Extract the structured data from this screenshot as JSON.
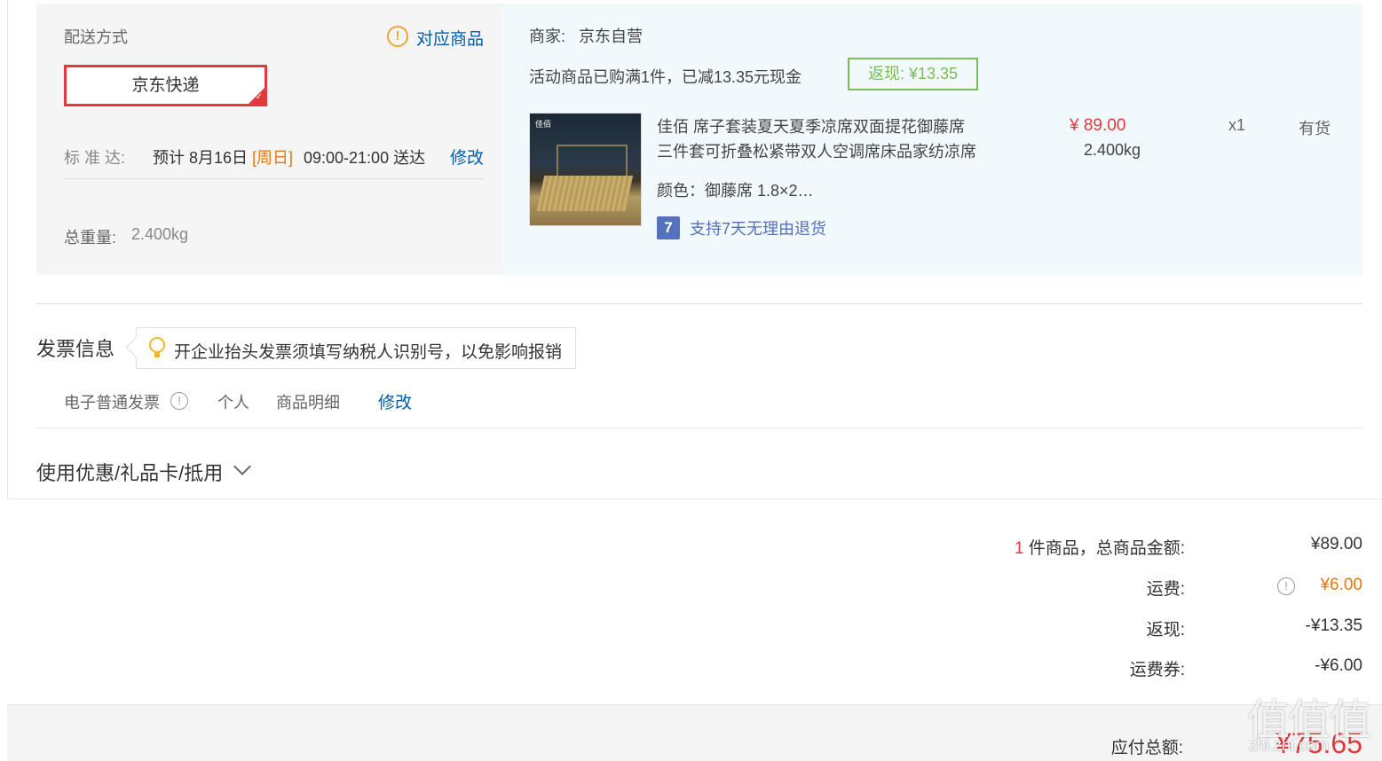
{
  "shipping": {
    "method_label": "配送方式",
    "products_link": "对应商品",
    "option": "京东快递",
    "standard_label": "标 准 达:",
    "estimate_prefix": "预计 8月16日",
    "estimate_day": "[周日]",
    "estimate_time": "09:00-21:00 送达",
    "edit_link": "修改",
    "total_weight_label": "总重量:",
    "total_weight": "2.400kg"
  },
  "merchant": {
    "label": "商家:",
    "name": "京东自营",
    "promo_text": "活动商品已购满1件，已减13.35元现金",
    "cashback": "返现: ¥13.35"
  },
  "product": {
    "image_brand": "佳佰",
    "title_line1": "佳佰 席子套装夏天夏季凉席双面提花御藤席",
    "title_line2": "三件套可折叠松紧带双人空调席床品家纺凉席",
    "price": "¥ 89.00",
    "weight": "2.400kg",
    "quantity": "x1",
    "stock": "有货",
    "variant": "颜色：御藤席 1.8×2…",
    "return_badge": "7",
    "return_policy": "支持7天无理由退货"
  },
  "invoice": {
    "title": "发票信息",
    "tip": "开企业抬头发票须填写纳税人识别号，以免影响报销",
    "type": "电子普通发票",
    "info_icon": "!",
    "holder": "个人",
    "content": "商品明细",
    "edit_link": "修改"
  },
  "coupon": {
    "label": "使用优惠/礼品卡/抵用"
  },
  "summary": {
    "count": "1",
    "count_suffix": " 件商品，总商品金额:",
    "goods_amount": "¥89.00",
    "freight_label": "运费:",
    "freight_info_icon": "!",
    "freight": "¥6.00",
    "cashback_label": "返现:",
    "cashback": "-¥13.35",
    "freight_coupon_label": "运费券:",
    "freight_coupon": "-¥6.00",
    "payable_label": "应付总额:",
    "payable": "¥75.65"
  },
  "watermark": {
    "big": "值值值",
    "small": "zhi.zhi.com"
  },
  "colors": {
    "accent_red": "#e4393c",
    "link_blue": "#005ea7",
    "cashback_green": "#7abd54",
    "freight_orange": "#e4780c"
  }
}
